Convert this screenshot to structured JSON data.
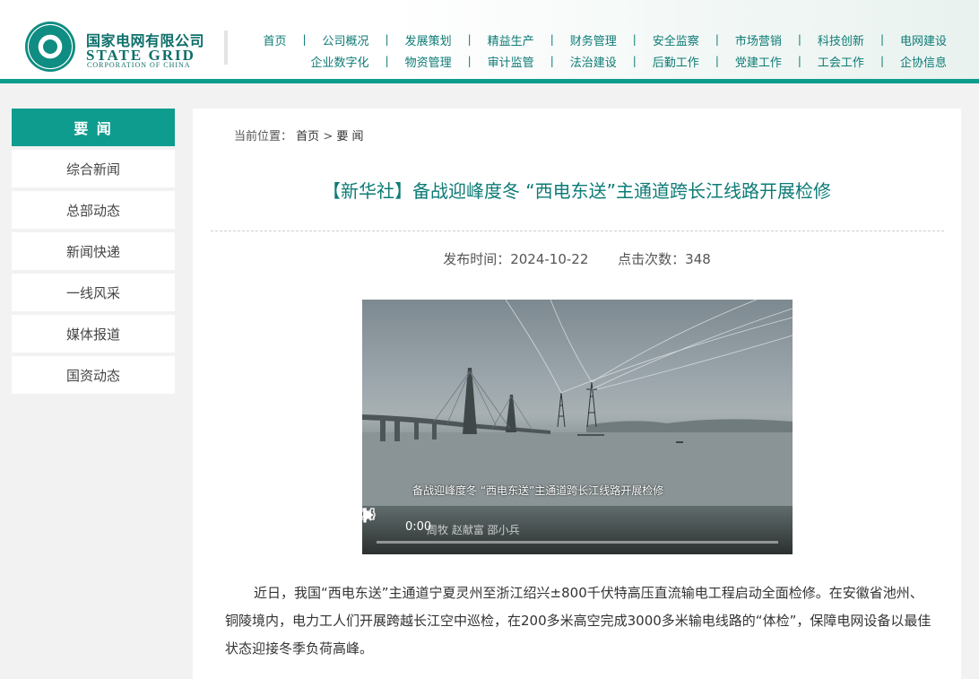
{
  "header": {
    "logo_cn": "国家电网有限公司",
    "logo_en": "STATE GRID",
    "logo_en_sub": "CORPORATION OF CHINA",
    "nav_row1": [
      "首页",
      "公司概况",
      "发展策划",
      "精益生产",
      "财务管理",
      "安全监察",
      "市场营销",
      "科技创新",
      "电网建设"
    ],
    "nav_row2": [
      "企业数字化",
      "物资管理",
      "审计监管",
      "法治建设",
      "后勤工作",
      "党建工作",
      "工会工作",
      "企协信息"
    ],
    "separator": "|"
  },
  "sidebar": {
    "title": "要 闻",
    "items": [
      "综合新闻",
      "总部动态",
      "新闻快递",
      "一线风采",
      "媒体报道",
      "国资动态"
    ]
  },
  "article": {
    "breadcrumb_label": "当前位置：",
    "breadcrumb_home": "首页",
    "breadcrumb_sep": ">",
    "breadcrumb_current": "要 闻",
    "title": "【新华社】备战迎峰度冬 “西电东送”主通道跨长江线路开展检修",
    "publish_time": "发布时间：2024-10-22",
    "click_count": "点击次数：348",
    "body": "近日，我国“西电东送”主通道宁夏灵州至浙江绍兴±800千伏特高压直流输电工程启动全面检修。在安徽省池州、铜陵境内，电力工人们开展跨越长江空中巡检，在200多米高空完成3000多米输电线路的“体检”，保障电网设备以最佳状态迎接冬季负荷高峰。"
  },
  "video": {
    "caption": "备战迎峰度冬  “西电东送”主通道跨长江线路开展检修",
    "time": "0:00",
    "credits": "周牧 赵献富 邵小兵",
    "progress": 0
  },
  "colors": {
    "accent": "#0e9c8e",
    "nav_text": "#0d7b76"
  }
}
